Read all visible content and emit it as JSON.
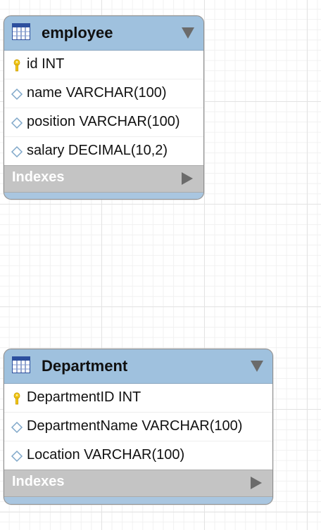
{
  "tables": {
    "employee": {
      "title": "employee",
      "columns": [
        {
          "text": "id INT",
          "icon": "key-icon"
        },
        {
          "text": "name VARCHAR(100)",
          "icon": "diamond-icon"
        },
        {
          "text": "position VARCHAR(100)",
          "icon": "diamond-icon"
        },
        {
          "text": "salary DECIMAL(10,2)",
          "icon": "diamond-icon"
        }
      ],
      "indexes_label": "Indexes"
    },
    "department": {
      "title": "Department",
      "columns": [
        {
          "text": "DepartmentID INT",
          "icon": "key-icon"
        },
        {
          "text": "DepartmentName VARCHAR(100)",
          "icon": "diamond-icon"
        },
        {
          "text": "Location VARCHAR(100)",
          "icon": "diamond-icon"
        }
      ],
      "indexes_label": "Indexes"
    }
  },
  "colors": {
    "header": "#9fc1de",
    "key": "#f2c81a",
    "diamond": "#7fa7c9",
    "indexes_bar": "#c4c4c4"
  }
}
